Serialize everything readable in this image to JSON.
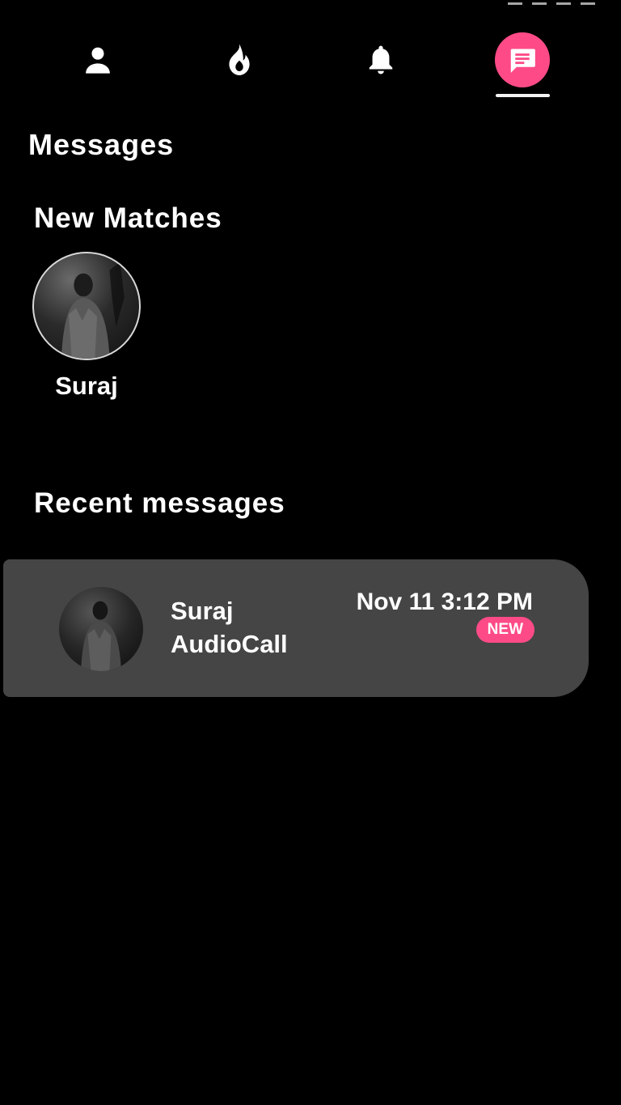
{
  "nav": {
    "tabs": [
      {
        "icon": "person-icon",
        "active": false
      },
      {
        "icon": "flame-icon",
        "active": false
      },
      {
        "icon": "bell-icon",
        "active": false
      },
      {
        "icon": "chat-icon",
        "active": true
      }
    ],
    "accent_color": "#fe4b87"
  },
  "page": {
    "title": "Messages"
  },
  "new_matches": {
    "heading": "New Matches",
    "items": [
      {
        "name": "Suraj"
      }
    ]
  },
  "recent_messages": {
    "heading": "Recent messages",
    "items": [
      {
        "name": "Suraj",
        "preview": "AudioCall",
        "timestamp": "Nov 11 3:12 PM",
        "badge": "NEW"
      }
    ]
  }
}
